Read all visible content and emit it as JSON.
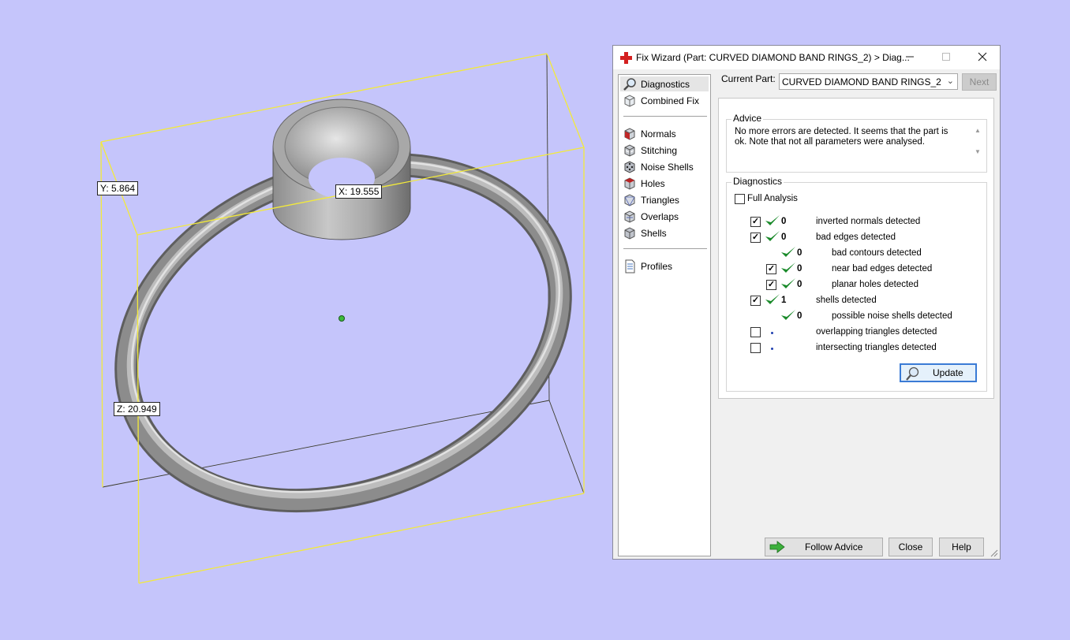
{
  "viewport": {
    "dim_x": "X: 19.555",
    "dim_y": "Y: 5.864",
    "dim_z": "Z: 20.949"
  },
  "dialog": {
    "title": "Fix Wizard (Part: CURVED DIAMOND BAND RINGS_2) > Diag...",
    "nav": [
      {
        "label": "Diagnostics",
        "icon": "magnifier-icon",
        "selected": true
      },
      {
        "label": "Combined Fix",
        "icon": "cube-icon"
      },
      {
        "label": "Normals",
        "icon": "normals-cube-icon"
      },
      {
        "label": "Stitching",
        "icon": "stitching-cube-icon"
      },
      {
        "label": "Noise Shells",
        "icon": "dice-icon"
      },
      {
        "label": "Holes",
        "icon": "holes-cube-icon"
      },
      {
        "label": "Triangles",
        "icon": "triangles-cube-icon"
      },
      {
        "label": "Overlaps",
        "icon": "overlaps-cube-icon"
      },
      {
        "label": "Shells",
        "icon": "shells-cube-icon"
      },
      {
        "label": "Profiles",
        "icon": "document-icon"
      }
    ],
    "current_part_label": "Current Part:",
    "current_part_value": "CURVED DIAMOND BAND RINGS_2",
    "next_label": "Next",
    "advice_title": "Advice",
    "advice_text": "No more errors are detected. It seems that the part is ok. Note that not all parameters were analysed.",
    "diagnostics_title": "Diagnostics",
    "full_analysis_label": "Full Analysis",
    "rows": [
      {
        "checked": true,
        "count": "0",
        "label": "inverted normals detected"
      },
      {
        "checked": true,
        "count": "0",
        "label": "bad edges detected"
      },
      {
        "checked": null,
        "count": "0",
        "label": "bad contours detected"
      },
      {
        "checked": true,
        "count": "0",
        "label": "near bad edges detected"
      },
      {
        "checked": true,
        "count": "0",
        "label": "planar holes detected"
      },
      {
        "checked": true,
        "count": "1",
        "label": "shells detected"
      },
      {
        "checked": null,
        "count": "0",
        "label": "possible noise shells detected"
      },
      {
        "checked": false,
        "count": "",
        "label": "overlapping triangles detected"
      },
      {
        "checked": false,
        "count": "",
        "label": "intersecting triangles detected"
      }
    ],
    "update_label": "Update",
    "follow_advice_label": "Follow Advice",
    "close_label": "Close",
    "help_label": "Help"
  }
}
